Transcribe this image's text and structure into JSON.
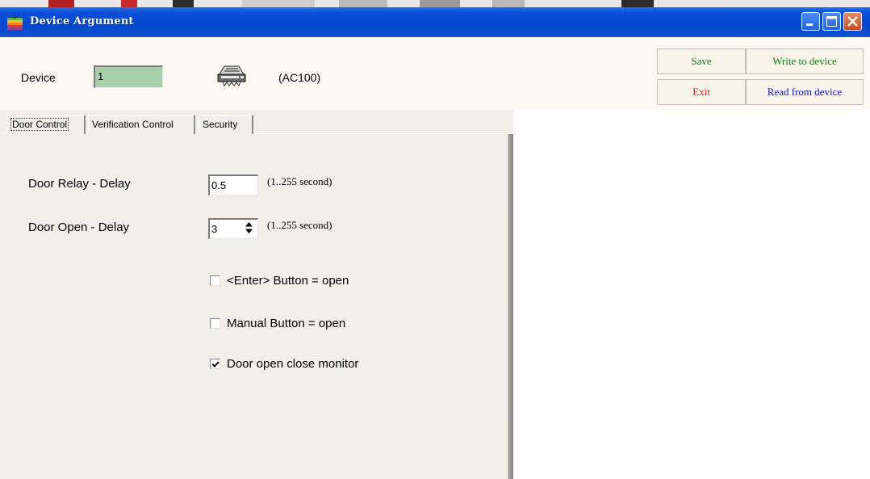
{
  "window": {
    "title": "Device Argument"
  },
  "header": {
    "device_label": "Device",
    "device_value": "1",
    "model": "(AC100)"
  },
  "buttons": {
    "save": "Save",
    "exit": "Exit",
    "write": "Write to device",
    "read": "Read from device"
  },
  "tabs": [
    "Door Control",
    "Verification Control",
    "Security"
  ],
  "door_control": {
    "relay_label": "Door Relay - Delay",
    "relay_value": "0.5",
    "relay_hint": "(1..255 second)",
    "open_label": "Door Open - Delay",
    "open_value": "3",
    "open_hint": "(1..255 second)",
    "checkboxes": [
      {
        "label": "<Enter> Button = open",
        "checked": false
      },
      {
        "label": "Manual Button = open",
        "checked": false
      },
      {
        "label": "Door open close monitor",
        "checked": true
      }
    ]
  },
  "colors": {
    "title_bar": "#0348d0",
    "device_field": "#a6cfaa",
    "save_text": "#157a15",
    "exit_text": "#e02020",
    "read_text": "#1515c8"
  },
  "icons": [
    "app-icon",
    "device-icon",
    "minimize-icon",
    "maximize-icon",
    "close-icon",
    "spin-arrows-icon",
    "check-icon"
  ]
}
